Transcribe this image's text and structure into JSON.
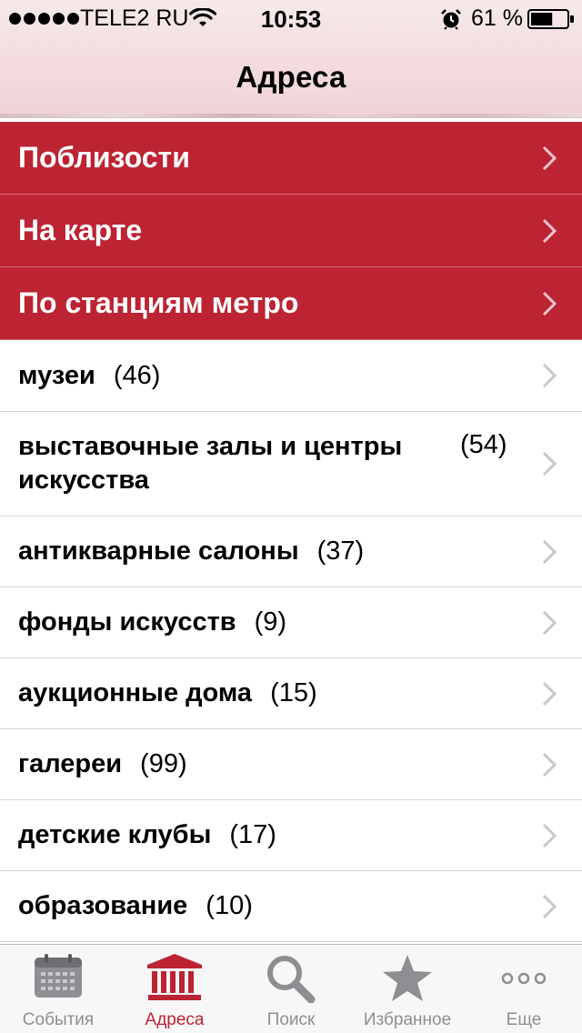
{
  "status": {
    "carrier": "TELE2 RU",
    "time": "10:53",
    "battery_percent": "61 %",
    "battery_level": 0.61,
    "signal_bars": 5,
    "icons": [
      "wifi-icon",
      "alarm-icon",
      "battery-icon"
    ]
  },
  "nav": {
    "title": "Адреса"
  },
  "sections": [
    {
      "label": "Поблизости"
    },
    {
      "label": "На карте"
    },
    {
      "label": "По станциям метро"
    }
  ],
  "categories": [
    {
      "label": "музеи",
      "count": "(46)"
    },
    {
      "label": "выставочные залы и центры искусства",
      "count": "(54)"
    },
    {
      "label": "антикварные салоны",
      "count": "(37)"
    },
    {
      "label": "фонды искусств",
      "count": "(9)"
    },
    {
      "label": "аукционные дома",
      "count": "(15)"
    },
    {
      "label": "галереи",
      "count": "(99)"
    },
    {
      "label": "детские клубы",
      "count": "(17)"
    },
    {
      "label": "образование",
      "count": "(10)"
    }
  ],
  "tabs": [
    {
      "label": "События",
      "icon": "calendar-icon",
      "active": false
    },
    {
      "label": "Адреса",
      "icon": "building-icon",
      "active": true
    },
    {
      "label": "Поиск",
      "icon": "search-icon",
      "active": false
    },
    {
      "label": "Избранное",
      "icon": "star-icon",
      "active": false
    },
    {
      "label": "Еще",
      "icon": "more-icon",
      "active": false
    }
  ],
  "colors": {
    "accent": "#bc2333",
    "tab_inactive": "#8e8e93",
    "chevron": "#c7c7cc"
  }
}
